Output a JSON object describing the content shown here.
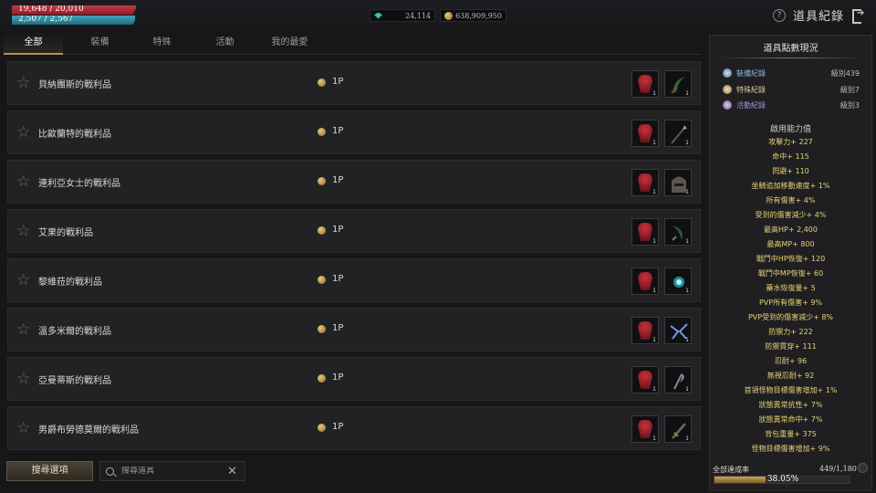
{
  "player": {
    "hp_text": "19,648 / 20,010",
    "hp_ratio": 0.982,
    "mp_text": "2,507 / 2,567",
    "mp_ratio": 0.977
  },
  "currency": {
    "crystal": "24,114",
    "crystal_icon": "crystal-icon",
    "silver": "638,909,950",
    "silver_icon": "silver-coin-icon"
  },
  "header": {
    "title": "道具紀錄",
    "help_icon": "help-icon",
    "exit_icon": "exit-icon"
  },
  "tabs": [
    {
      "label": "全部",
      "active": true
    },
    {
      "label": "裝備",
      "active": false
    },
    {
      "label": "特殊",
      "active": false
    },
    {
      "label": "活動",
      "active": false
    },
    {
      "label": "我的最愛",
      "active": false
    }
  ],
  "items": [
    {
      "name": "貝納團斯的戰利品",
      "points": "1P",
      "slot1_qty": "1",
      "slot2_qty": "1",
      "slot2_icon": "sickle-icon"
    },
    {
      "name": "比歐蘭特的戰利品",
      "points": "1P",
      "slot1_qty": "1",
      "slot2_qty": "1",
      "slot2_icon": "spear-icon"
    },
    {
      "name": "連利亞女士的戰利品",
      "points": "1P",
      "slot1_qty": "1",
      "slot2_qty": "1",
      "slot2_icon": "helmet-icon"
    },
    {
      "name": "艾果的戰利品",
      "points": "1P",
      "slot1_qty": "1",
      "slot2_qty": "1",
      "slot2_icon": "claw-icon"
    },
    {
      "name": "黎維菈的戰利品",
      "points": "1P",
      "slot1_qty": "1",
      "slot2_qty": "1",
      "slot2_icon": "orb-icon"
    },
    {
      "name": "溫多米爾的戰利品",
      "points": "1P",
      "slot1_qty": "1",
      "slot2_qty": "1",
      "slot2_icon": "lightning-wings-icon"
    },
    {
      "name": "亞曼蒂斯的戰利品",
      "points": "1P",
      "slot1_qty": "1",
      "slot2_qty": "1",
      "slot2_icon": "scythe-icon"
    },
    {
      "name": "男爵布勞德莫爾的戰利品",
      "points": "1P",
      "slot1_qty": "1",
      "slot2_qty": "1",
      "slot2_icon": "dagger-icon"
    }
  ],
  "bottom": {
    "filter_label": "搜尋選項",
    "search_placeholder": "搜尋道具"
  },
  "panel": {
    "title": "道具點數現況",
    "records": [
      {
        "label": "裝備紀錄",
        "level": "級別439",
        "color": "#8fb6d6"
      },
      {
        "label": "特殊紀錄",
        "level": "級別7",
        "color": "#d8c9a3"
      },
      {
        "label": "活動紀錄",
        "level": "級別3",
        "color": "#a98fd6"
      }
    ],
    "stats_title": "啟用能力值",
    "stats": [
      "攻擊力+ 227",
      "命中+ 115",
      "閃避+ 110",
      "坐騎追加移動速度+ 1%",
      "所有傷害+ 4%",
      "受到的傷害減少+ 4%",
      "最高HP+ 2,400",
      "最高MP+ 800",
      "戰鬥中HP恢復+ 120",
      "戰鬥中MP恢復+ 60",
      "藥水恢復量+ 5",
      "PVP所有傷害+ 9%",
      "PVP受到的傷害減少+ 8%",
      "防禦力+ 222",
      "防禦貫穿+ 111",
      "忍耐+ 96",
      "無視忍耐+ 92",
      "首領怪物目標傷害增加+ 1%",
      "狀態異常抗性+ 7%",
      "狀態異常命中+ 7%",
      "背包重量+ 375",
      "怪物目標傷害增加+ 9%"
    ],
    "achievement_label": "全部達成率",
    "achievement_value": "449/1,180",
    "progress_text": "38.05%",
    "progress_ratio": 0.3805
  }
}
